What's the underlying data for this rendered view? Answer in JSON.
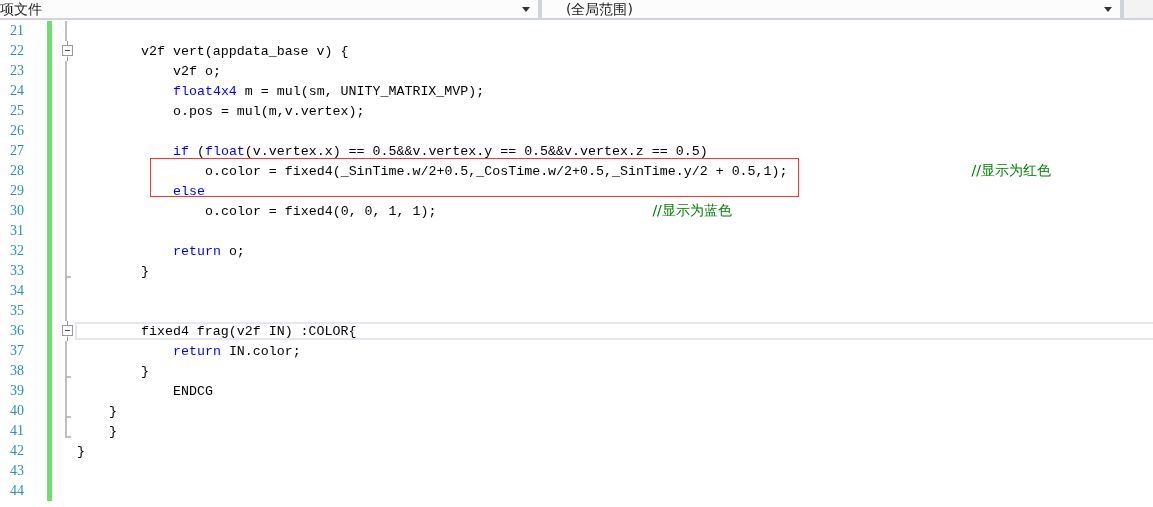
{
  "navigation_bar": {
    "left_dropdown": "项文件",
    "right_dropdown": "(全局范围)"
  },
  "lines": [
    {
      "number": "21",
      "kind": "line",
      "current": false
    },
    {
      "number": "22",
      "kind": "collapse",
      "current": false,
      "segments": [
        {
          "kind": "code",
          "text": "        v2f vert(appdata_base v) {"
        }
      ]
    },
    {
      "number": "23",
      "kind": "line",
      "current": false,
      "segments": [
        {
          "kind": "code",
          "text": "            v2f o;"
        }
      ]
    },
    {
      "number": "24",
      "kind": "line",
      "current": false,
      "segments": [
        {
          "kind": "keyword",
          "text": "            float4x4"
        },
        {
          "kind": "code",
          "text": " m = mul(sm, UNITY_MATRIX_MVP);"
        }
      ]
    },
    {
      "number": "25",
      "kind": "line",
      "current": false,
      "segments": [
        {
          "kind": "code",
          "text": "            o.pos = mul(m,v.vertex);"
        }
      ]
    },
    {
      "number": "26",
      "kind": "line",
      "current": false
    },
    {
      "number": "27",
      "kind": "line",
      "current": false,
      "segments": [
        {
          "kind": "keyword",
          "text": "            if"
        },
        {
          "kind": "code",
          "text": " ("
        },
        {
          "kind": "keyword",
          "text": "float"
        },
        {
          "kind": "code",
          "text": "(v.vertex.x) == 0.5&&v.vertex.y == 0.5&&v.vertex.z == 0.5)"
        }
      ]
    },
    {
      "number": "28",
      "kind": "line",
      "current": false,
      "segments": [
        {
          "kind": "code",
          "text": "                o.color = fixed4(_SinTime.w/2+0.5,_CosTime.w/2+0.5,_SinTime.y/2 + 0.5,1);"
        },
        {
          "kind": "comment",
          "text": "//显示为红色"
        }
      ]
    },
    {
      "number": "29",
      "kind": "line",
      "current": false,
      "segments": [
        {
          "kind": "keyword",
          "text": "            else"
        }
      ]
    },
    {
      "number": "30",
      "kind": "line",
      "current": false,
      "segments": [
        {
          "kind": "code",
          "text": "                o.color = fixed4(0, 0, 1, 1);"
        },
        {
          "kind": "comment",
          "text": "//显示为蓝色"
        }
      ]
    },
    {
      "number": "31",
      "kind": "line",
      "current": false
    },
    {
      "number": "32",
      "kind": "line",
      "current": false,
      "segments": [
        {
          "kind": "keyword",
          "text": "            return"
        },
        {
          "kind": "code",
          "text": " o;"
        }
      ]
    },
    {
      "number": "33",
      "kind": "end",
      "current": false,
      "segments": [
        {
          "kind": "code",
          "text": "        }"
        }
      ]
    },
    {
      "number": "34",
      "kind": "line",
      "current": false
    },
    {
      "number": "35",
      "kind": "line",
      "current": false
    },
    {
      "number": "36",
      "kind": "collapse",
      "current": true,
      "segments": [
        {
          "kind": "code",
          "text": "        fixed4 frag(v2f IN) :COLOR{"
        }
      ]
    },
    {
      "number": "37",
      "kind": "line",
      "current": false,
      "segments": [
        {
          "kind": "keyword",
          "text": "            return"
        },
        {
          "kind": "code",
          "text": " IN.color;"
        }
      ]
    },
    {
      "number": "38",
      "kind": "end",
      "current": false,
      "segments": [
        {
          "kind": "code",
          "text": "        }"
        }
      ]
    },
    {
      "number": "39",
      "kind": "line",
      "current": false,
      "segments": [
        {
          "kind": "code",
          "text": "            ENDCG"
        }
      ]
    },
    {
      "number": "40",
      "kind": "end",
      "current": false,
      "segments": [
        {
          "kind": "code",
          "text": "    }"
        }
      ]
    },
    {
      "number": "41",
      "kind": "last",
      "current": false,
      "segments": [
        {
          "kind": "code",
          "text": "    }"
        }
      ]
    },
    {
      "number": "42",
      "kind": "none",
      "current": false,
      "segments": [
        {
          "kind": "code",
          "text": "}"
        }
      ]
    },
    {
      "number": "43",
      "kind": "none",
      "current": false
    },
    {
      "number": "44",
      "kind": "none",
      "current": false
    }
  ]
}
